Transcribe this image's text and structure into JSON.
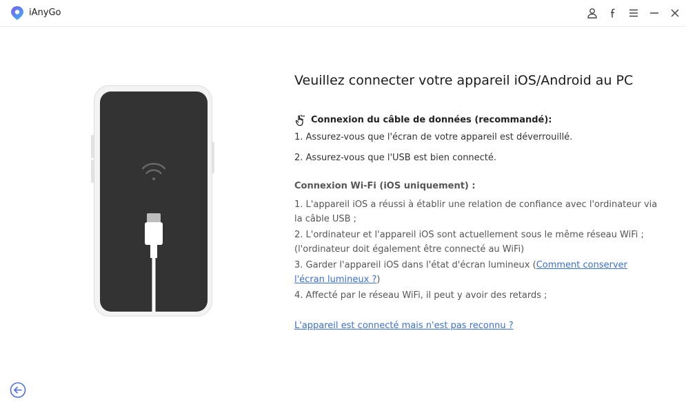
{
  "app": {
    "name": "iAnyGo"
  },
  "titlebar": {
    "icons": [
      "account-icon",
      "facebook-icon",
      "menu-icon",
      "minimize-icon",
      "close-icon"
    ]
  },
  "main": {
    "heading": "Veuillez connecter votre appareil iOS/Android au PC",
    "cable": {
      "title": "Connexion du câble de données (recommandé):",
      "steps": [
        "1. Assurez-vous que l'écran de votre appareil est déverrouillé.",
        "2. Assurez-vous que l'USB est bien connecté."
      ]
    },
    "wifi": {
      "title": "Connexion Wi-Fi (iOS uniquement) :",
      "step1_line1": "1. L'appareil iOS a réussi à établir une relation de confiance avec l'ordinateur via",
      "step1_line2": "la câble USB ;",
      "step2_line1": "2. L'ordinateur et l'appareil iOS sont actuellement sous le même réseau WiFi ;",
      "step2_line2": "(l'ordinateur doit également être connecté au WiFi)",
      "step3_text": "3. Garder l'appareil iOS dans l'état d'écran lumineux  (",
      "step3_link_part1": "Comment conserver",
      "step3_link_part2": "l'écran lumineux ?",
      "step3_close": ")",
      "step4": "4. Affecté par le réseau WiFi, il peut y avoir des retards ;"
    },
    "help_link": "L'appareil est connecté mais n'est pas reconnu ?"
  },
  "colors": {
    "accent": "#3b6fd1",
    "phone_screen": "#333333",
    "back_button": "#4a6fd8"
  }
}
